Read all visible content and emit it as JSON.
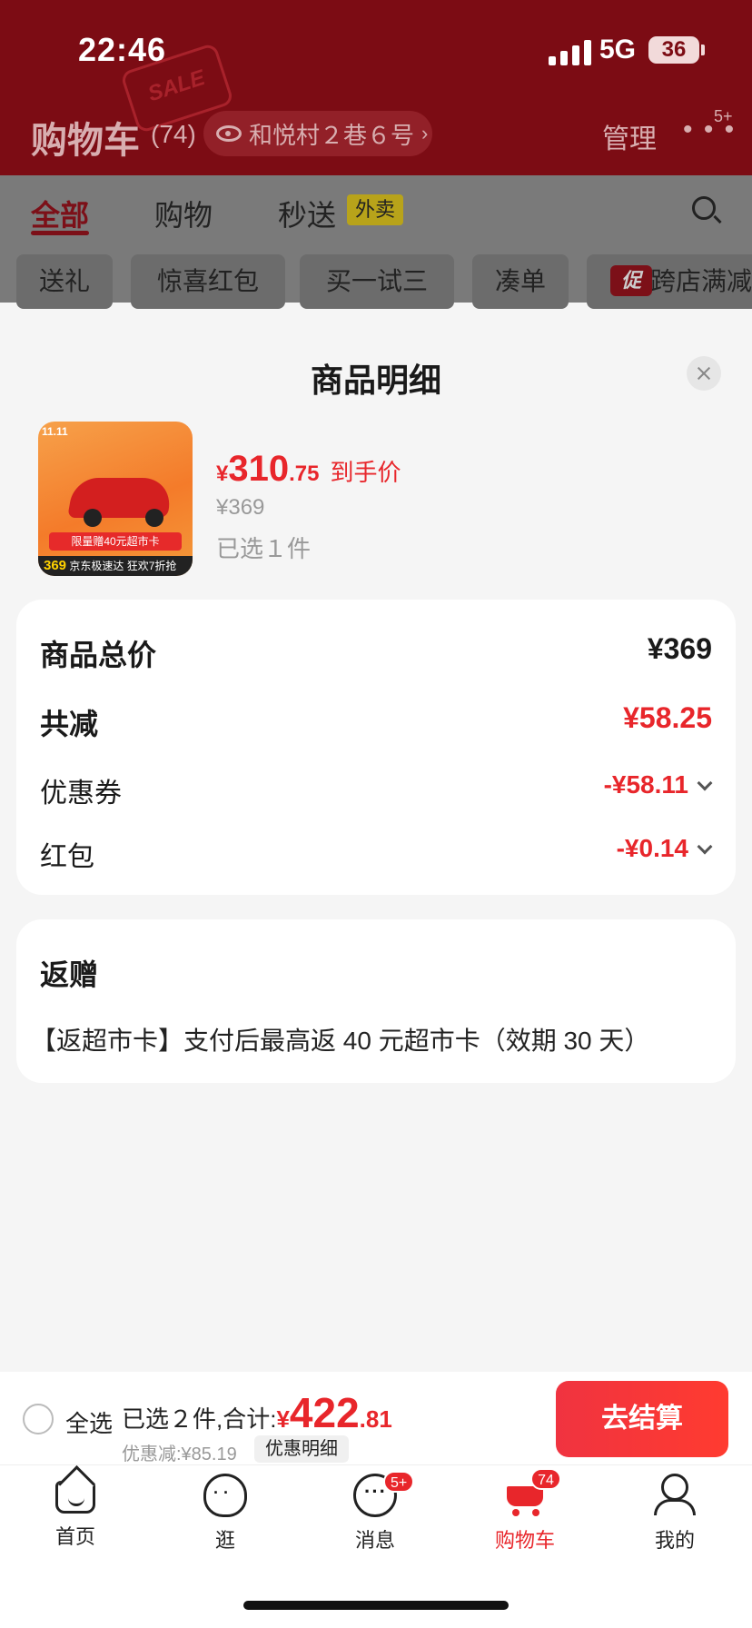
{
  "status_bar": {
    "time": "22:46",
    "network": "5G",
    "battery": "36"
  },
  "header": {
    "title": "购物车",
    "count": "(74)",
    "address": "和悦村２巷６号",
    "manage_label": "管理",
    "more_badge": "5+",
    "decor_text": "SALE"
  },
  "tabs": {
    "all": "全部",
    "shop": "购物",
    "fast": "秒送",
    "waimai_badge": "外卖"
  },
  "chips": [
    "送礼",
    "惊喜红包",
    "买一试三",
    "凑单",
    "跨店满减"
  ],
  "promo_chip_icon": "促",
  "sheet": {
    "title": "商品明细",
    "product": {
      "price_symbol": "¥",
      "price_int": "310",
      "price_dec": ".75",
      "price_label": "到手价",
      "original_price": "¥369",
      "selected": "已选１件",
      "image_tag": "11.11",
      "image_banner": "限量赠40元超市卡",
      "image_footer_price": "369",
      "image_footer_text": "京东极速达 狂欢7折抢"
    },
    "price_card": {
      "total_label": "商品总价",
      "total_value": "¥369",
      "reduce_label": "共减",
      "reduce_value": "¥58.25",
      "coupon_label": "优惠券",
      "coupon_value": "-¥58.11",
      "redpacket_label": "红包",
      "redpacket_value": "-¥0.14"
    },
    "rebate_card": {
      "title": "返赠",
      "text": "【返超市卡】支付后最高返 40 元超市卡（效期 30 天）"
    }
  },
  "checkout": {
    "select_all": "全选",
    "summary_prefix": "已选２件,合计:",
    "total_symbol": "¥",
    "total_int": "422",
    "total_dec": ".81",
    "discount": "优惠减:¥85.19",
    "detail_label": "优惠明细",
    "button_label": "去结算"
  },
  "tabbar": {
    "home": "首页",
    "guang": "逛",
    "messages": "消息",
    "messages_badge": "5+",
    "cart": "购物车",
    "cart_badge": "74",
    "me": "我的"
  },
  "colors": {
    "accent": "#e8262b",
    "header_dim": "#7c0c14"
  }
}
